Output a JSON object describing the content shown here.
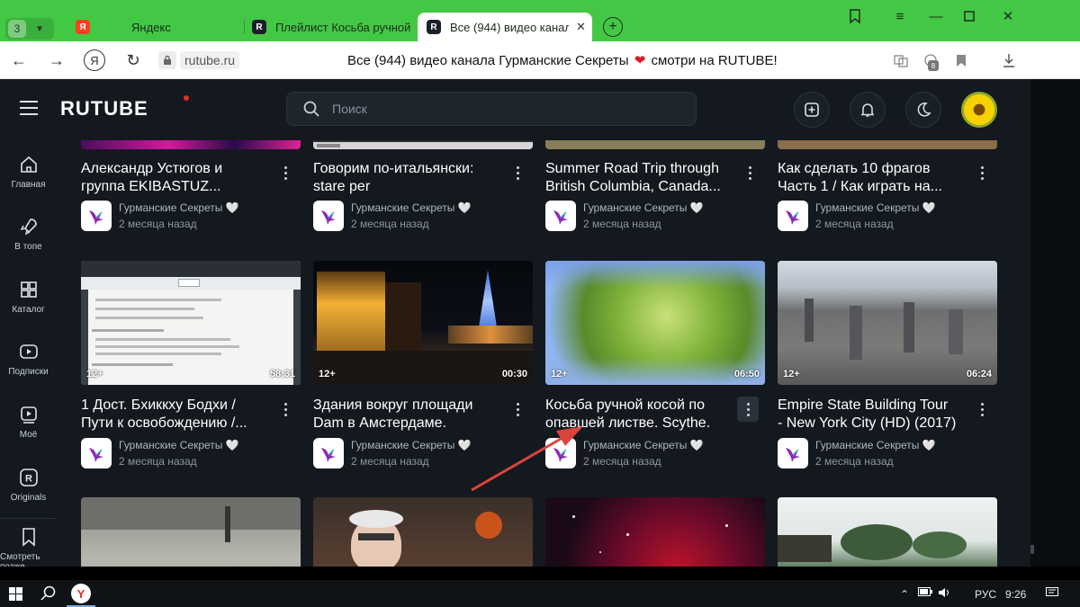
{
  "browser": {
    "tab_count": "3",
    "tabs": [
      {
        "label": "Яндекс",
        "icon": "yandex-icon"
      },
      {
        "label": "Плейлист Косьба ручной",
        "icon": "rutube-icon"
      },
      {
        "label": "Все (944) видео канала",
        "icon": "rutube-icon",
        "active": true
      }
    ],
    "address": {
      "domain": "rutube.ru",
      "title_before": "Все (944) видео канала Гурманские Секреты",
      "title_after": "смотри на RUTUBE!"
    },
    "ya_button": "Я",
    "downloads_badge": "8"
  },
  "rutube": {
    "logo": "RUTUBE",
    "search_placeholder": "Поиск",
    "sidebar": [
      {
        "label": "Главная",
        "icon": "home-icon"
      },
      {
        "label": "В топе",
        "icon": "rocket-icon"
      },
      {
        "label": "Каталог",
        "icon": "grid-icon"
      },
      {
        "label": "Подписки",
        "icon": "subscriptions-icon"
      },
      {
        "label": "Моё",
        "icon": "my-video-icon"
      },
      {
        "label": "Originals",
        "icon": "originals-icon"
      },
      {
        "label": "Смотреть позже",
        "icon": "bookmark-icon"
      }
    ],
    "channel": "Гурманские Секреты",
    "heart": "🤍",
    "videos_row1": [
      {
        "title1": "Александр Устюгов и",
        "title2": "группа EKIBASTUZ...",
        "date": "2 месяца назад"
      },
      {
        "title1": "Говорим по-итальянски:",
        "title2": "stare per",
        "date": "2 месяца назад"
      },
      {
        "title1": "Summer Road Trip through",
        "title2": "British Columbia, Canada...",
        "date": "2 месяца назад"
      },
      {
        "title1": "Как сделать 10 фрагов",
        "title2": "Часть 1 / Как играть на...",
        "date": "2 месяца назад"
      }
    ],
    "videos_row2": [
      {
        "title1": "1 Дост. Бхиккху Бодхи /",
        "title2": "Пути к освобождению /...",
        "date": "2 месяца назад",
        "age": "12+",
        "duration": "58:31"
      },
      {
        "title1": "Здания вокруг площади",
        "title2": "Dam в Амстердаме.",
        "date": "2 месяца назад",
        "age": "12+",
        "duration": "00:30"
      },
      {
        "title1": "Косьба ручной косой по",
        "title2": "опавшей листве. Scythe.",
        "date": "2 месяца назад",
        "age": "12+",
        "duration": "06:50"
      },
      {
        "title1": "Empire State Building Tour",
        "title2": "- New York City (HD) (2017)",
        "date": "2 месяца назад",
        "age": "12+",
        "duration": "06:24"
      }
    ]
  },
  "taskbar": {
    "lang": "РУС",
    "time": "9:26"
  },
  "colors": {
    "tabstrip": "#43c845",
    "rutube_bg": "#14191f",
    "annotation_arrow": "#d9453b"
  }
}
